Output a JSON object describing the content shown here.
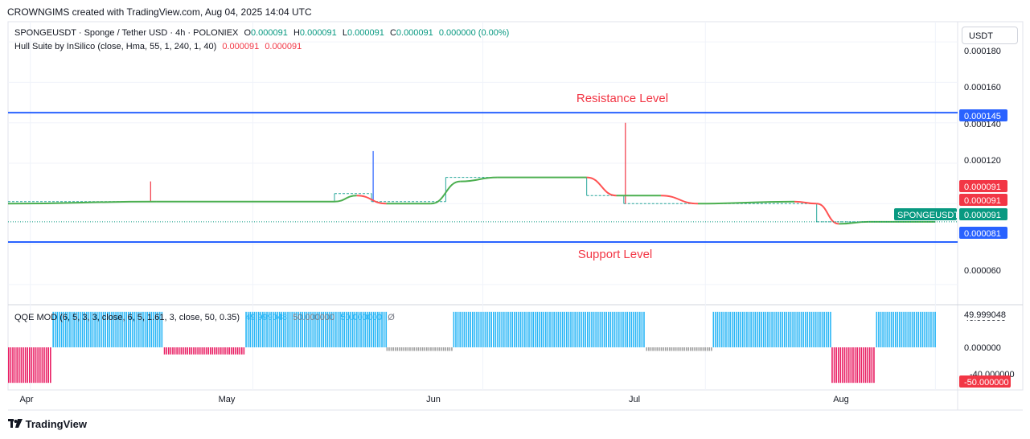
{
  "header": {
    "caption": "CROWNGIMS created with TradingView.com, Aug 04, 2025 14:04 UTC"
  },
  "legend": {
    "symbol": "SPONGEUSDT · Sponge / Tether USD · 4h · POLONIEX",
    "o_label": "O",
    "o_value": "0.000091",
    "h_label": "H",
    "h_value": "0.000091",
    "l_label": "L",
    "l_value": "0.000091",
    "c_label": "C",
    "c_value": "0.000091",
    "change": "0.000000 (0.00%)",
    "indicator": "Hull Suite by InSilico (close, Hma, 55, 1, 240, 1, 40)",
    "ind_v1": "0.000091",
    "ind_v2": "0.000091"
  },
  "osc_legend": {
    "name": "QQE MOD (6, 5, 3, 3, close, 6, 5, 1.61, 3, close, 50, 0.35)",
    "v1": "49.999048",
    "v2": "50.000000",
    "v3": "50.000000",
    "v4": "Ø"
  },
  "currency": "USDT",
  "annotations": {
    "resistance": "Resistance Level",
    "support": "Support Level"
  },
  "price_axis": {
    "ticks": [
      "0.000180",
      "0.000160",
      "0.000140",
      "0.000120",
      "0.000060"
    ],
    "tag_resistance": "0.000145",
    "tag_hull_1": "0.000091",
    "tag_hull_2": "0.000091",
    "tag_symbol": "SPONGEUSDT",
    "tag_last": "0.000091",
    "tag_support": "0.000081"
  },
  "osc_axis": {
    "ticks": [
      "49.999048",
      "40.000000",
      "0.000000",
      "-40.000000"
    ],
    "tag_low": "-50.000000"
  },
  "time_axis": [
    "Apr",
    "May",
    "Jun",
    "Jul",
    "Aug"
  ],
  "footer": {
    "brand": "TradingView"
  },
  "colors": {
    "level_line": "#2962ff",
    "annotation": "#f23645",
    "hull_up": "#4caf50",
    "hull_down": "#ff5252",
    "price_line": "#089981",
    "osc_up": "#29b6f6",
    "osc_down": "#e91e63",
    "osc_neutral": "#9e9e9e"
  },
  "chart_data": {
    "type": "line",
    "title": "SPONGEUSDT · Sponge / Tether USD · 4h · POLONIEX",
    "time_range": [
      "2025-03-29",
      "2025-08-04"
    ],
    "price_range": [
      5e-05,
      0.00019
    ],
    "levels": [
      {
        "label": "Resistance Level",
        "value": 0.000145
      },
      {
        "label": "Support Level",
        "value": 8.1e-05
      }
    ],
    "price_segments": [
      {
        "from": "2025-03-29",
        "to": "2025-04-17",
        "value": 0.000101
      },
      {
        "from": "2025-04-17",
        "to": "2025-05-12",
        "value": 0.000101,
        "spike_high": 0.000111
      },
      {
        "from": "2025-05-12",
        "to": "2025-05-17",
        "value": 0.000105
      },
      {
        "from": "2025-05-17",
        "to": "2025-05-27",
        "value": 0.000101,
        "spike_high": 0.000126
      },
      {
        "from": "2025-05-27",
        "to": "2025-06-15",
        "value": 0.000113
      },
      {
        "from": "2025-06-15",
        "to": "2025-06-20",
        "value": 0.000104
      },
      {
        "from": "2025-06-20",
        "to": "2025-07-16",
        "value": 0.0001,
        "spike_high": 0.00014
      },
      {
        "from": "2025-07-16",
        "to": "2025-08-01",
        "value": 9.1e-05
      }
    ],
    "hull": [
      {
        "t": "2025-03-29",
        "v": 0.0001
      },
      {
        "t": "2025-04-18",
        "v": 0.000101
      },
      {
        "t": "2025-04-22",
        "v": 0.000101
      },
      {
        "t": "2025-05-12",
        "v": 0.000101
      },
      {
        "t": "2025-05-15",
        "v": 0.000104
      },
      {
        "t": "2025-05-19",
        "v": 0.0001
      },
      {
        "t": "2025-05-25",
        "v": 0.0001
      },
      {
        "t": "2025-05-29",
        "v": 0.000111
      },
      {
        "t": "2025-06-03",
        "v": 0.000113
      },
      {
        "t": "2025-06-15",
        "v": 0.000113
      },
      {
        "t": "2025-06-19",
        "v": 0.000104
      },
      {
        "t": "2025-06-25",
        "v": 0.000104
      },
      {
        "t": "2025-06-30",
        "v": 0.0001
      },
      {
        "t": "2025-07-13",
        "v": 0.000101
      },
      {
        "t": "2025-07-16",
        "v": 0.0001
      },
      {
        "t": "2025-07-19",
        "v": 9e-05
      },
      {
        "t": "2025-07-23",
        "v": 9.1e-05
      },
      {
        "t": "2025-08-01",
        "v": 9.1e-05
      }
    ],
    "qqe": {
      "y_range": [
        -60,
        60
      ],
      "bars": [
        {
          "from": "2025-03-29",
          "to": "2025-04-04",
          "value": -50,
          "state": "down"
        },
        {
          "from": "2025-04-04",
          "to": "2025-04-19",
          "value": 50,
          "state": "up"
        },
        {
          "from": "2025-04-19",
          "to": "2025-04-30",
          "value": -10,
          "state": "down"
        },
        {
          "from": "2025-04-30",
          "to": "2025-05-19",
          "value": 50,
          "state": "up"
        },
        {
          "from": "2025-05-19",
          "to": "2025-05-28",
          "value": -5,
          "state": "neutral"
        },
        {
          "from": "2025-05-28",
          "to": "2025-06-23",
          "value": 50,
          "state": "up"
        },
        {
          "from": "2025-06-23",
          "to": "2025-07-02",
          "value": -5,
          "state": "neutral"
        },
        {
          "from": "2025-07-02",
          "to": "2025-07-18",
          "value": 50,
          "state": "up"
        },
        {
          "from": "2025-07-18",
          "to": "2025-07-24",
          "value": -50,
          "state": "down"
        },
        {
          "from": "2025-07-24",
          "to": "2025-08-01",
          "value": 50,
          "state": "up"
        }
      ]
    }
  }
}
